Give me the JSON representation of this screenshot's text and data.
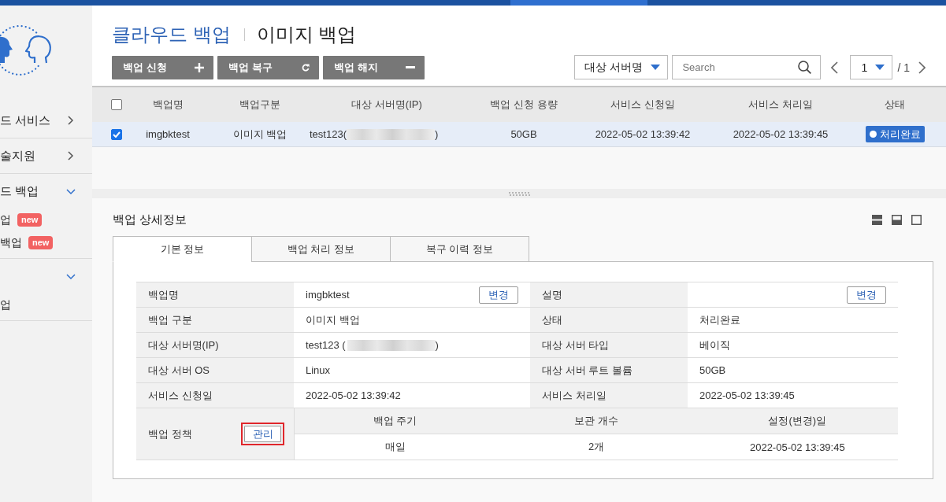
{
  "sidebar": {
    "items": [
      {
        "label": "드 서비스",
        "expanded": false
      },
      {
        "label": "술지원",
        "expanded": false
      },
      {
        "label": "드 백업",
        "expanded": true,
        "children": [
          {
            "label": "업",
            "badge": "new"
          },
          {
            "label": "백업",
            "badge": "new"
          }
        ]
      },
      {
        "expanded": true,
        "children": [
          {
            "label": "업"
          }
        ]
      }
    ]
  },
  "header": {
    "breadcrumb": "클라우드 백업",
    "title": "이미지 백업"
  },
  "toolbar": {
    "buttons": [
      {
        "label": "백업 신청",
        "kind": "apply"
      },
      {
        "label": "백업 복구",
        "kind": "restore"
      },
      {
        "label": "백업 해지",
        "kind": "terminate"
      }
    ],
    "filter": {
      "value": "대상 서버명"
    },
    "search": {
      "placeholder": "Search"
    },
    "pagination": {
      "page": "1",
      "total": "/ 1"
    }
  },
  "table": {
    "select_all": false,
    "columns": [
      "백업명",
      "백업구분",
      "대상 서버명(IP)",
      "백업 신청 용량",
      "서비스 신청일",
      "서비스 처리일",
      "상태"
    ],
    "rows": [
      {
        "selected": true,
        "checked": true,
        "name": "imgbktest",
        "type": "이미지 백업",
        "server": "test123(",
        "server_redacted": true,
        "server_end": ")",
        "size": "50GB",
        "requested": "2022-05-02 13:39:42",
        "processed": "2022-05-02 13:39:45",
        "status": "처리완료"
      }
    ]
  },
  "detail": {
    "title": "백업 상세정보",
    "tabs": [
      {
        "label": "기본 정보",
        "selected": true
      },
      {
        "label": "백업 처리 정보",
        "selected": false
      },
      {
        "label": "복구 이력 정보",
        "selected": false
      }
    ],
    "rows": [
      {
        "cells": [
          {
            "label": "백업명",
            "value": "imgbktest",
            "button": "변경"
          },
          {
            "label": "설명",
            "button": "변경"
          }
        ]
      },
      {
        "cells": [
          {
            "label": "백업 구분",
            "value": "이미지 백업"
          },
          {
            "label": "상태",
            "value": "처리완료"
          }
        ]
      },
      {
        "cells": [
          {
            "label": "대상 서버명(IP)",
            "value": "test123 (",
            "redacted": true,
            "value_end": ")"
          },
          {
            "label": "대상 서버 타입",
            "value": "베이직"
          }
        ]
      },
      {
        "cells": [
          {
            "label": "대상 서버 OS",
            "value": "Linux"
          },
          {
            "label": "대상 서버 루트 볼륨",
            "value": "50GB"
          }
        ]
      },
      {
        "cells": [
          {
            "label": "서비스 신청일",
            "value": "2022-05-02 13:39:42"
          },
          {
            "label": "서비스 처리일",
            "value": "2022-05-02 13:39:45"
          }
        ]
      }
    ],
    "policy": {
      "label": "백업 정책",
      "button": "관리",
      "highlighted": true,
      "columns": [
        "백업 주기",
        "보관 개수",
        "설정(변경)일"
      ],
      "values": [
        "매일",
        "2개",
        "2022-05-02 13:39:45"
      ]
    }
  }
}
